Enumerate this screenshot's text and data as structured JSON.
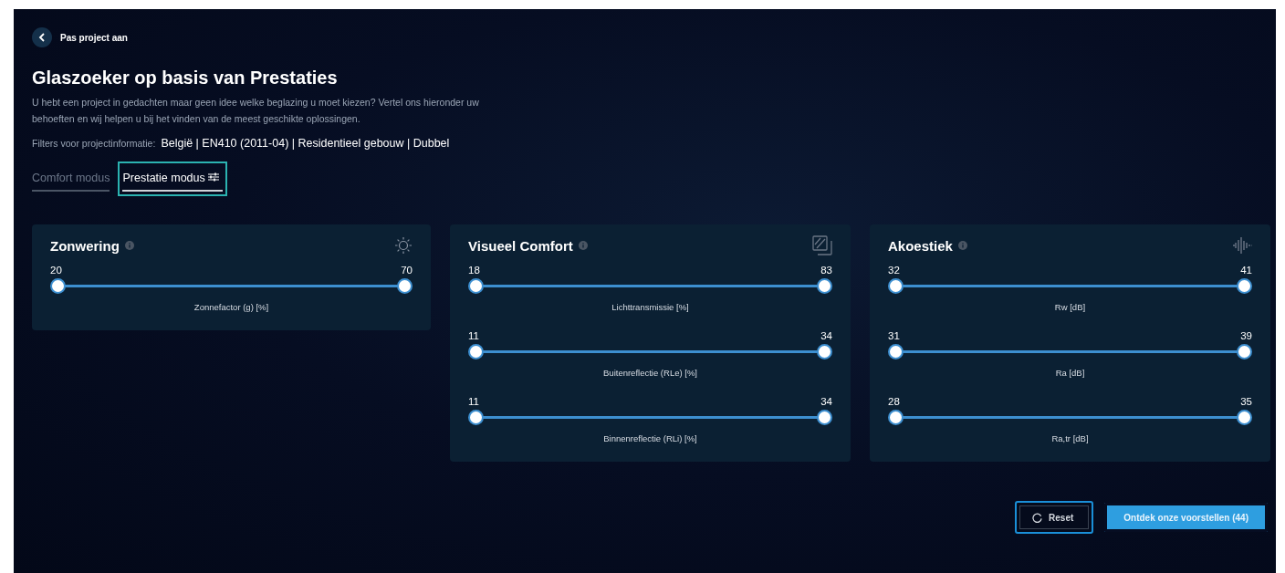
{
  "back_link": {
    "label": "Pas project aan"
  },
  "title": "Glaszoeker op basis van Prestaties",
  "description": "U hebt een project in gedachten maar geen idee welke beglazing u moet kiezen? Vertel ons hieronder uw behoeften en wij helpen u bij het vinden van de meest geschikte oplossingen.",
  "filters": {
    "label": "Filters voor projectinformatie:",
    "value": "België | EN410 (2011-04) | Residentieel gebouw | Dubbel"
  },
  "tabs": [
    {
      "label": "Comfort modus",
      "selected": false
    },
    {
      "label": "Prestatie modus",
      "selected": true
    }
  ],
  "cards": [
    {
      "title": "Zonwering",
      "kind": "sun",
      "sliders": [
        {
          "min": "20",
          "max": "70",
          "label": "Zonnefactor (g) [%]",
          "thumbs": [
            {
              "level": 0
            },
            {
              "level": 1
            }
          ]
        }
      ]
    },
    {
      "title": "Visueel Comfort",
      "kind": "glass",
      "sliders": [
        {
          "min": "18",
          "max": "83",
          "label": "Lichttransmissie [%]",
          "thumbs": [
            {
              "level": 0
            },
            {
              "level": 1
            }
          ]
        },
        {
          "min": "11",
          "max": "34",
          "label": "Buitenreflectie (RLe) [%]",
          "thumbs": [
            {
              "level": 0
            },
            {
              "level": 1
            }
          ]
        },
        {
          "min": "11",
          "max": "34",
          "label": "Binnenreflectie (RLi) [%]",
          "thumbs": [
            {
              "level": 0
            },
            {
              "level": 1
            }
          ]
        }
      ]
    },
    {
      "title": "Akoestiek",
      "kind": "sound",
      "sliders": [
        {
          "min": "32",
          "max": "41",
          "label": "Rw [dB]",
          "thumbs": [
            {
              "level": 0
            },
            {
              "level": 1
            }
          ]
        },
        {
          "min": "31",
          "max": "39",
          "label": "Ra [dB]",
          "thumbs": [
            {
              "level": 0
            },
            {
              "level": 1
            }
          ]
        },
        {
          "min": "28",
          "max": "35",
          "label": "Ra,tr [dB]",
          "thumbs": [
            {
              "level": 0
            },
            {
              "level": 1
            }
          ]
        }
      ]
    }
  ],
  "buttons": [
    {
      "label": "Reset",
      "kind": "reset",
      "focused": true
    },
    {
      "label": "Ontdek onze voorstellen (44)",
      "kind": "primary",
      "focused": false
    }
  ]
}
